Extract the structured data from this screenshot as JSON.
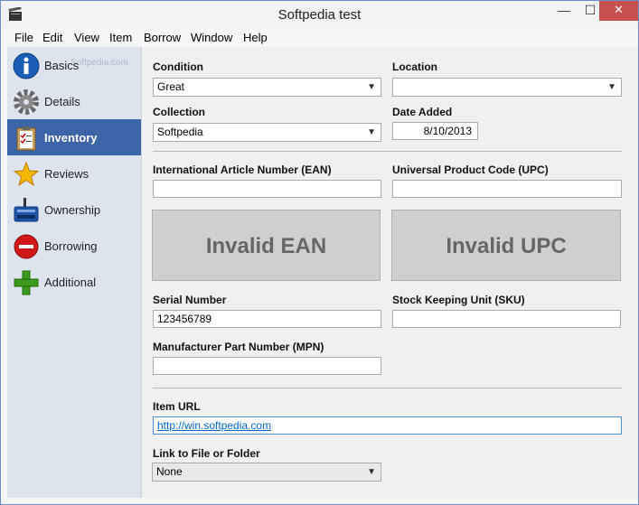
{
  "window": {
    "title": "Softpedia test",
    "min": "—",
    "max": "☐",
    "close": "✕"
  },
  "menu": [
    "File",
    "Edit",
    "View",
    "Item",
    "Borrow",
    "Window",
    "Help"
  ],
  "watermark": "Softpedia.com",
  "sidebar": {
    "items": [
      {
        "label": "Basics",
        "icon": "info-icon"
      },
      {
        "label": "Details",
        "icon": "gear-icon"
      },
      {
        "label": "Inventory",
        "icon": "clipboard-icon",
        "active": true
      },
      {
        "label": "Reviews",
        "icon": "star-icon"
      },
      {
        "label": "Ownership",
        "icon": "cash-register-icon"
      },
      {
        "label": "Borrowing",
        "icon": "no-entry-icon"
      },
      {
        "label": "Additional",
        "icon": "plus-icon"
      }
    ]
  },
  "form": {
    "condition": {
      "label": "Condition",
      "value": "Great"
    },
    "location": {
      "label": "Location",
      "value": ""
    },
    "collection": {
      "label": "Collection",
      "value": "Softpedia"
    },
    "date_added": {
      "label": "Date Added",
      "value": "8/10/2013"
    },
    "ean": {
      "label": "International Article Number (EAN)",
      "value": "",
      "status": "Invalid EAN"
    },
    "upc": {
      "label": "Universal Product Code (UPC)",
      "value": "",
      "status": "Invalid UPC"
    },
    "serial": {
      "label": "Serial Number",
      "value": "123456789"
    },
    "sku": {
      "label": "Stock Keeping Unit (SKU)",
      "value": ""
    },
    "mpn": {
      "label": "Manufacturer Part Number (MPN)",
      "value": ""
    },
    "item_url": {
      "label": "Item URL",
      "value": "http://win.softpedia.com"
    },
    "link_file": {
      "label": "Link to File or Folder",
      "value": "None"
    }
  }
}
